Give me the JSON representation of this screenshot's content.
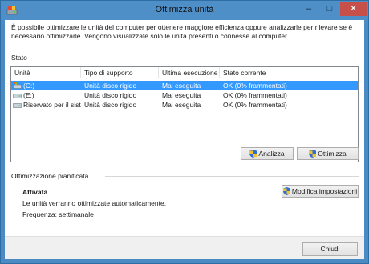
{
  "window": {
    "title": "Ottimizza unità",
    "minimize": "–",
    "maximize": "□",
    "close": "✕"
  },
  "intro_text": "È possibile ottimizzare le unità del computer per ottenere maggiore efficienza oppure analizzarle per rilevare se è necessario ottimizzarle. Vengono visualizzate solo le unità presenti o connesse al computer.",
  "status": {
    "label": "Stato",
    "columns": [
      "Unità",
      "Tipo di supporto",
      "Ultima esecuzione",
      "Stato corrente"
    ],
    "rows": [
      {
        "drive": "(C:)",
        "type": "Unità disco rigido",
        "last_run": "Mai eseguita",
        "status": "OK (0% frammentati)",
        "icon": "windows-drive-icon",
        "selected": true
      },
      {
        "drive": "(E:)",
        "type": "Unità disco rigido",
        "last_run": "Mai eseguita",
        "status": "OK (0% frammentati)",
        "icon": "hard-drive-icon",
        "selected": false
      },
      {
        "drive": "Riservato per il sist...",
        "type": "Unità disco rigido",
        "last_run": "Mai eseguita",
        "status": "OK (0% frammentati)",
        "icon": "hard-drive-icon",
        "selected": false
      }
    ]
  },
  "buttons": {
    "analyze": "Analizza",
    "optimize": "Ottimizza",
    "change_settings": "Modifica impostazioni",
    "close": "Chiudi"
  },
  "schedule": {
    "label": "Ottimizzazione pianificata",
    "state": "Attivata",
    "description": "Le unità verranno ottimizzate automaticamente.",
    "frequency": "Frequenza: settimanale"
  },
  "colors": {
    "titlebar": "#4f8fc8",
    "selection": "#3399ff",
    "close_button": "#c7504a"
  }
}
